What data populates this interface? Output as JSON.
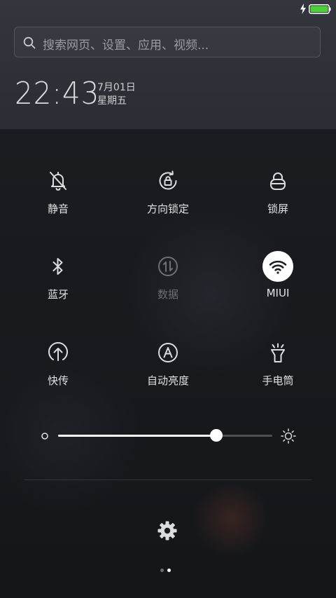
{
  "status_bar": {
    "charge_icon": "charging-bolt-icon",
    "battery_icon": "battery-icon",
    "battery_color": "#4cd137"
  },
  "search": {
    "placeholder": "搜索网页、设置、应用、视频..."
  },
  "clock": {
    "time": "22:43",
    "date": "7月01日",
    "weekday": "星期五"
  },
  "toggles": [
    {
      "label": "静音",
      "icon": "bell-muted-icon",
      "state": "off"
    },
    {
      "label": "方向锁定",
      "icon": "rotation-lock-icon",
      "state": "off"
    },
    {
      "label": "锁屏",
      "icon": "lock-icon",
      "state": "off"
    },
    {
      "label": "蓝牙",
      "icon": "bluetooth-icon",
      "state": "off"
    },
    {
      "label": "数据",
      "icon": "mobile-data-icon",
      "state": "disabled"
    },
    {
      "label": "MIUI",
      "icon": "wifi-icon",
      "state": "on"
    },
    {
      "label": "快传",
      "icon": "quick-transfer-icon",
      "state": "off"
    },
    {
      "label": "自动亮度",
      "icon": "auto-brightness-icon",
      "state": "off"
    },
    {
      "label": "手电筒",
      "icon": "flashlight-icon",
      "state": "off"
    }
  ],
  "brightness": {
    "level_fraction": 0.74,
    "min_icon": "brightness-low-icon",
    "max_icon": "brightness-high-icon"
  },
  "settings": {
    "icon": "gear-icon"
  },
  "pager": {
    "pages": 2,
    "current": 2,
    "active_color": "#ffffff",
    "inactive_color": "#6a6c71"
  },
  "colors": {
    "accent": "#ffffff",
    "icon": "#dcdcdc",
    "disabled": "#6d6f74"
  }
}
